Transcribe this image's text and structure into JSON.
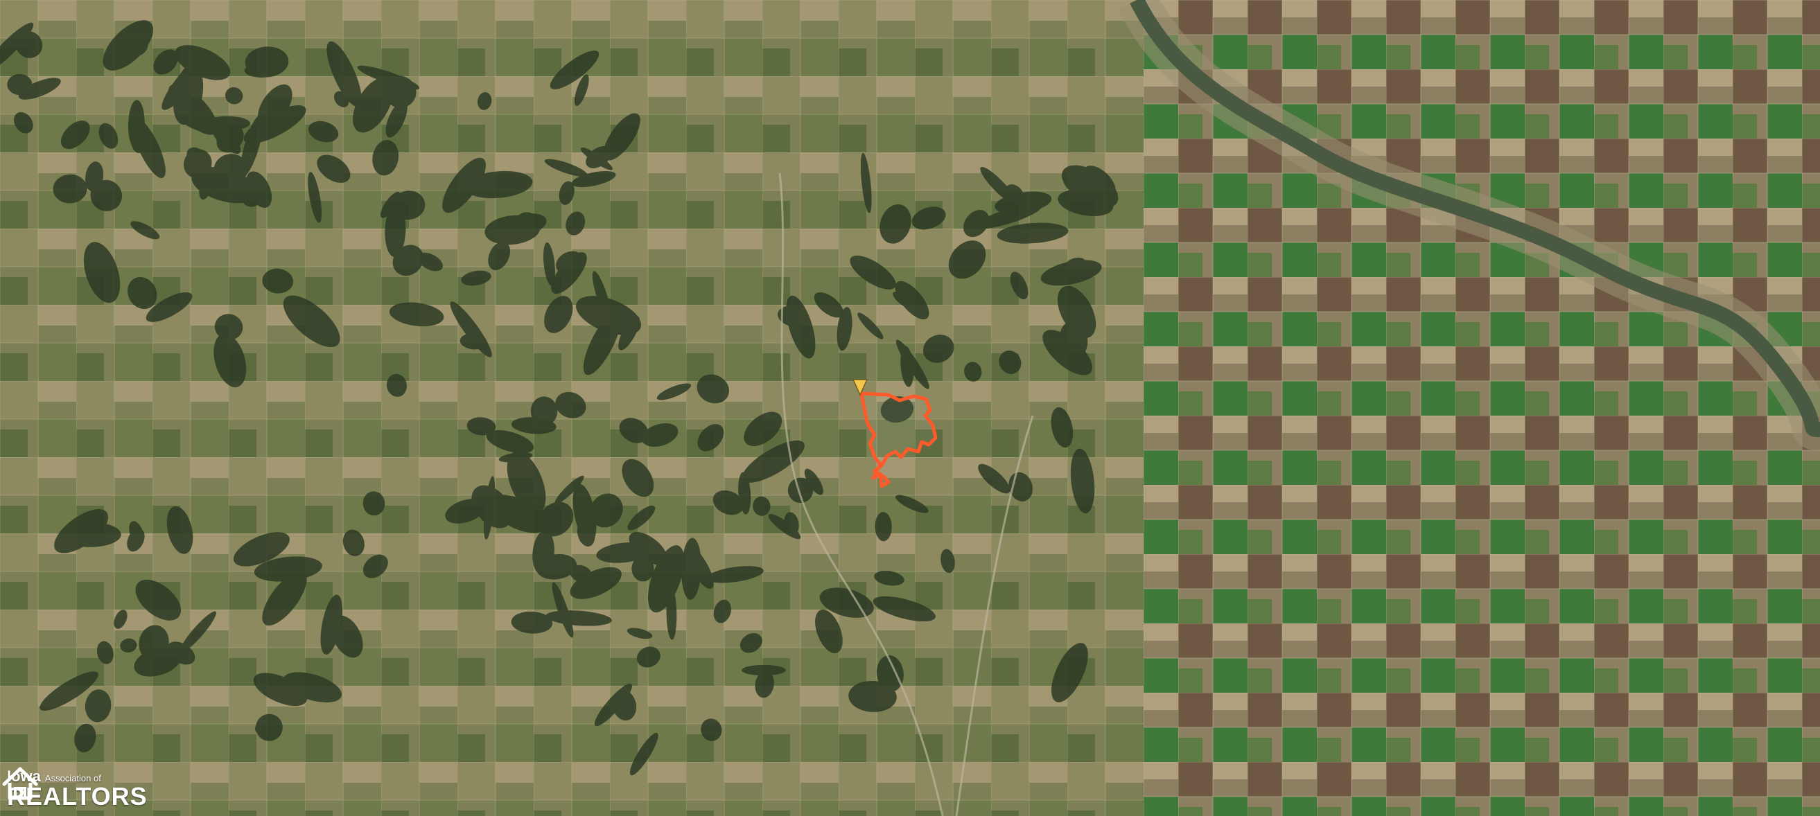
{
  "map": {
    "view": "satellite",
    "colors": {
      "base": "#5f6b45",
      "field_light": "#8b8a62",
      "field_tan": "#a59a72",
      "field_brown": "#6e5844",
      "field_green": "#3f7a3a",
      "forest": "#2b3a24",
      "river": "#4a5a42",
      "river_bank": "#9c9272",
      "parcel_outline": "#ff5a2a",
      "marker": "#f4c64a"
    },
    "parcel_marker_icon": "location-pin-icon"
  },
  "logo": {
    "state": "Iowa",
    "association": "Association of",
    "name": "REALTORS",
    "icon": "house-outline-logo"
  }
}
